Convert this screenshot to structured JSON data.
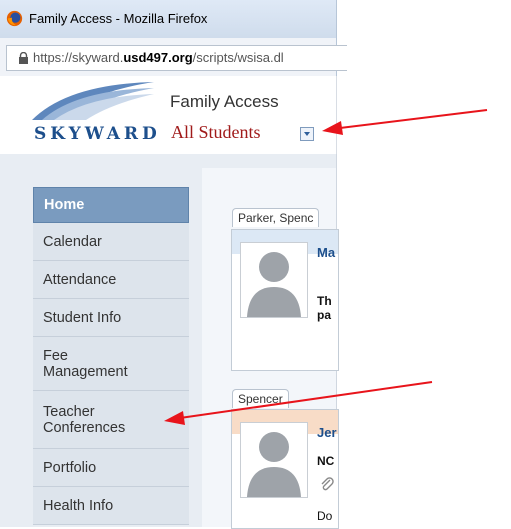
{
  "window": {
    "title": "Family Access - Mozilla Firefox"
  },
  "address_bar": {
    "url_prefix": "https://skyward.",
    "url_domain": "usd497.org",
    "url_path": "/scripts/wsisa.dl"
  },
  "header": {
    "logo_text": "SKYWARD",
    "app_title": "Family Access",
    "student_selector": "All Students"
  },
  "sidebar": {
    "items": [
      {
        "label": "Home",
        "active": true
      },
      {
        "label": "Calendar",
        "active": false
      },
      {
        "label": "Attendance",
        "active": false
      },
      {
        "label": "Student Info",
        "active": false
      },
      {
        "label": "Fee\nManagement",
        "active": false
      },
      {
        "label": "Teacher\nConferences",
        "active": false
      },
      {
        "label": "Portfolio",
        "active": false
      },
      {
        "label": "Health Info",
        "active": false
      }
    ]
  },
  "main": {
    "cards": [
      {
        "tab_label": "Parker, Spenc",
        "name": "Ma",
        "message": "Th\npa",
        "header_color": "#dce8f5"
      },
      {
        "tab_label": "Spencer",
        "name": "Jer",
        "message": "NC",
        "footer": "Do",
        "header_color": "#f8dcc7"
      }
    ]
  },
  "colors": {
    "accent": "#1d4f8c",
    "student_select": "#a01a1a",
    "nav_active": "#7a9bbf",
    "annotation_arrow": "#e8141b"
  },
  "icons": [
    "firefox-icon",
    "lock-icon",
    "dropdown-arrow-icon",
    "avatar-placeholder-icon",
    "paperclip-icon"
  ]
}
